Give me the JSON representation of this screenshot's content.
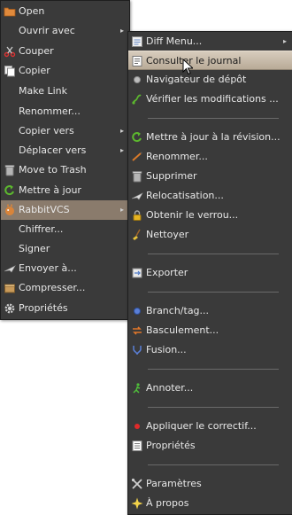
{
  "main_menu": {
    "items": [
      {
        "label": "Open",
        "icon": "folder-icon"
      },
      {
        "label": "Ouvrir avec",
        "submenu": true
      },
      {
        "label": "Couper",
        "icon": "scissors-icon"
      },
      {
        "label": "Copier",
        "icon": "copy-icon"
      },
      {
        "label": "Make Link"
      },
      {
        "label": "Renommer..."
      },
      {
        "label": "Copier vers",
        "submenu": true
      },
      {
        "label": "Déplacer vers",
        "submenu": true
      },
      {
        "label": "Move to Trash",
        "icon": "trash-icon"
      },
      {
        "label": "Mettre à jour",
        "icon": "update-arrow-icon"
      },
      {
        "label": "RabbitVCS",
        "icon": "rabbitvcs-icon",
        "submenu": true,
        "active": true
      },
      {
        "label": "Chiffrer..."
      },
      {
        "label": "Signer"
      },
      {
        "label": "Envoyer à...",
        "icon": "send-icon"
      },
      {
        "label": "Compresser...",
        "icon": "package-icon"
      },
      {
        "label": "Propriétés",
        "icon": "gear-icon"
      }
    ],
    "submenu_arrow": "▸"
  },
  "rabbitvcs_menu": {
    "items": [
      {
        "label": "Diff Menu...",
        "icon": "diff-icon",
        "submenu": true
      },
      {
        "label": "Consulter le journal",
        "icon": "log-icon",
        "highlighted": true
      },
      {
        "label": "Navigateur de dépôt",
        "icon": "repo-browser-icon"
      },
      {
        "label": "Vérifier les modifications ...",
        "icon": "check-modifications-icon"
      },
      {
        "label": "Mettre à jour à la révision...",
        "icon": "update-arrow-icon"
      },
      {
        "label": "Renommer...",
        "icon": "rename-icon"
      },
      {
        "label": "Supprimer",
        "icon": "trash-icon"
      },
      {
        "label": "Relocatisation...",
        "icon": "relocate-icon"
      },
      {
        "label": "Obtenir le verrou...",
        "icon": "lock-icon"
      },
      {
        "label": "Nettoyer",
        "icon": "broom-icon"
      },
      {
        "label": "Exporter",
        "icon": "export-icon"
      },
      {
        "label": "Branch/tag...",
        "icon": "branch-icon"
      },
      {
        "label": "Basculement...",
        "icon": "switch-icon"
      },
      {
        "label": "Fusion...",
        "icon": "merge-icon"
      },
      {
        "label": "Annoter...",
        "icon": "annotate-icon"
      },
      {
        "label": "Appliquer le correctif...",
        "icon": "patch-icon"
      },
      {
        "label": "Propriétés",
        "icon": "properties-icon"
      },
      {
        "label": "Paramètres",
        "icon": "settings-tools-icon"
      },
      {
        "label": "À propos",
        "icon": "about-star-icon"
      }
    ]
  },
  "colors": {
    "menu_bg": "#3a3a3a",
    "active_bg": "#8a7b6c",
    "highlight_bg": "#cdbfae",
    "text": "#e8e8e8",
    "separator": "#6a6a6a"
  }
}
